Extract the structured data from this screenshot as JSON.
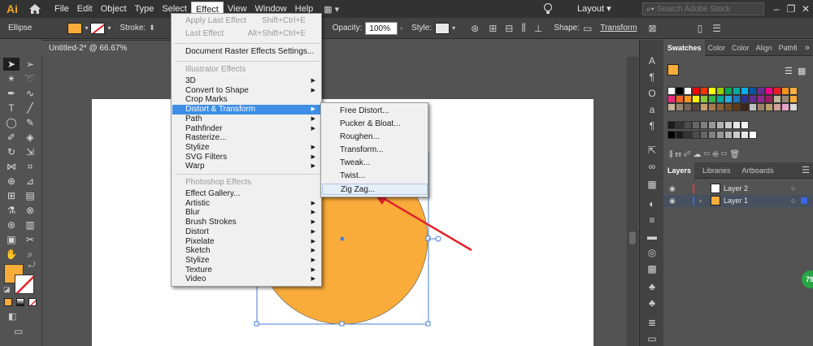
{
  "app": {
    "logo": "Ai"
  },
  "menubar": {
    "items": [
      "File",
      "Edit",
      "Object",
      "Type",
      "Select",
      "Effect",
      "View",
      "Window",
      "Help"
    ],
    "active": "Effect",
    "layout_label": "Layout",
    "search_placeholder": "Search Adobe Stock"
  },
  "controlbar": {
    "tool_name": "Ellipse",
    "stroke_label": "Stroke:",
    "opacity_label": "Opacity:",
    "opacity_value": "100%",
    "style_label": "Style:",
    "shape_label": "Shape:",
    "transform_label": "Transform"
  },
  "document": {
    "tab_title": "Untitled-2* @ 66.67% (RGB/Preview)",
    "close": "×"
  },
  "colors": {
    "fill": "#f9ac3a",
    "menu_highlight": "#3d8ee4",
    "arrow": "#e0242b"
  },
  "effect_menu": {
    "apply_last": {
      "label": "Apply Last Effect",
      "shortcut": "Shift+Ctrl+E"
    },
    "last": {
      "label": "Last Effect",
      "shortcut": "Alt+Shift+Ctrl+E"
    },
    "doc_settings": "Document Raster Effects Settings...",
    "illustrator_section": "Illustrator Effects",
    "illustrator_items": [
      "3D",
      "Convert to Shape",
      "Crop Marks",
      "Distort & Transform",
      "Path",
      "Pathfinder",
      "Rasterize...",
      "Stylize",
      "SVG Filters",
      "Warp"
    ],
    "photoshop_section": "Photoshop Effects",
    "photoshop_items": [
      "Effect Gallery...",
      "Artistic",
      "Blur",
      "Brush Strokes",
      "Distort",
      "Pixelate",
      "Sketch",
      "Stylize",
      "Texture",
      "Video"
    ]
  },
  "submenu": {
    "items": [
      "Free Distort...",
      "Pucker & Bloat...",
      "Roughen...",
      "Transform...",
      "Tweak...",
      "Twist...",
      "Zig Zag..."
    ],
    "hovered": "Zig Zag..."
  },
  "swatches_panel": {
    "tabs": [
      "Swatches",
      "Color",
      "Color",
      "Align",
      "Pathfi"
    ]
  },
  "layers_panel": {
    "tabs": [
      "Layers",
      "Libraries",
      "Artboards"
    ],
    "layers": [
      {
        "name": "Layer 2",
        "color": "#e23b3b"
      },
      {
        "name": "Layer 1",
        "color": "#3b66e2"
      }
    ]
  },
  "badge": "79"
}
